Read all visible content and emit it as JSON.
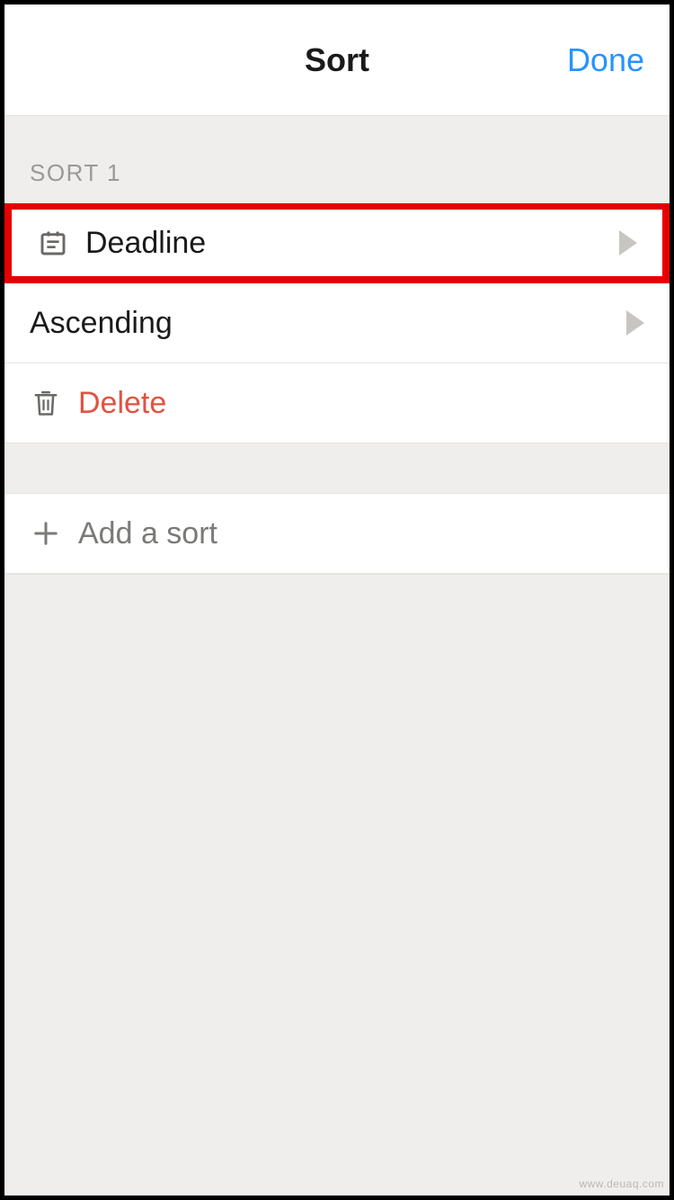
{
  "header": {
    "title": "Sort",
    "done": "Done"
  },
  "section": {
    "label": "SORT 1"
  },
  "sort": {
    "field": "Deadline",
    "direction": "Ascending",
    "delete": "Delete"
  },
  "add": {
    "label": "Add a sort"
  },
  "watermark": "www.deuaq.com"
}
